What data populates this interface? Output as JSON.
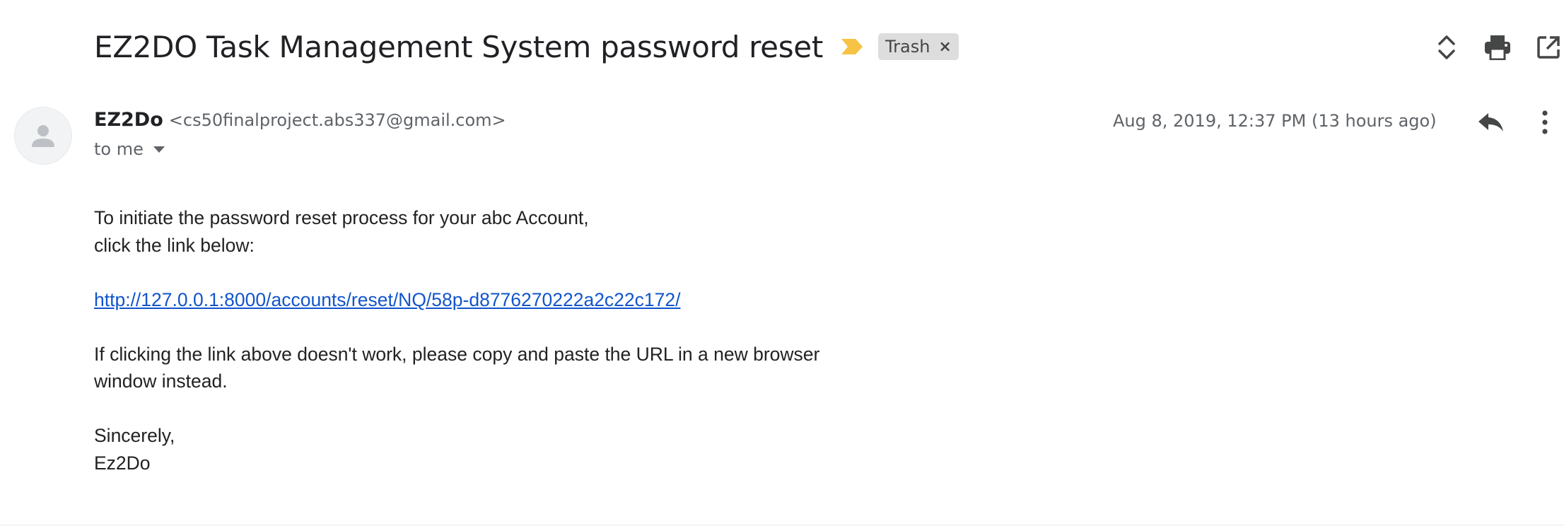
{
  "email": {
    "subject": "EZ2DO Task Management System password reset",
    "label": "Trash",
    "label_remove": "×",
    "sender": {
      "name": "EZ2Do",
      "email": "<cs50finalproject.abs337@gmail.com>"
    },
    "recipient": "to me",
    "timestamp": "Aug 8, 2019, 12:37 PM (13 hours ago)",
    "body": {
      "line1": "To initiate the password reset process for your abc Account,",
      "line2": "click the link below:",
      "link": "http://127.0.0.1:8000/accounts/reset/NQ/58p-d8776270222a2c22c172/",
      "line3": "If clicking the link above doesn't work, please copy and paste the URL in a new browser",
      "line4": "window instead.",
      "signoff": "Sincerely,",
      "signature": "Ez2Do"
    }
  },
  "icons": {
    "importance": "importance-marker-icon",
    "expand_collapse": "unfold-icon",
    "print": "print-icon",
    "open_new_window": "open-in-new-icon",
    "reply": "reply-icon",
    "more": "more-vert-icon",
    "avatar": "person-icon"
  },
  "colors": {
    "importance_marker": "#f6c344",
    "link": "#1155cc",
    "chip_background": "#dddddd",
    "secondary_text": "#5f6368"
  }
}
